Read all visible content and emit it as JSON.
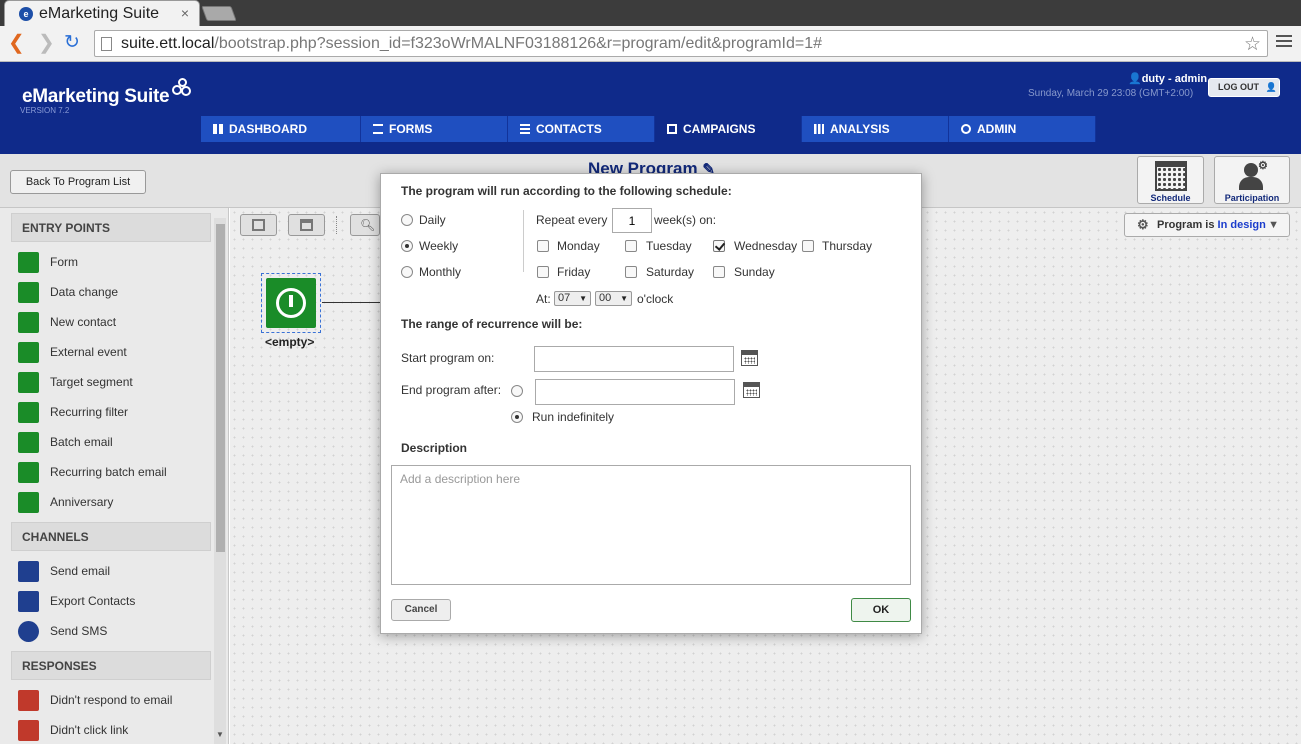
{
  "browser": {
    "tab_title": "eMarketing Suite",
    "tab_close": "×",
    "url_host": "suite.ett.local",
    "url_path": "/bootstrap.php?session_id=f323oWrMALNF03188126&r=program/edit&programId=1#"
  },
  "header": {
    "logo": "eMarketing Suite",
    "version": "VERSION 7.2",
    "user": "duty - admin",
    "datetime": "Sunday, March 29 23:08 (GMT+2:00)",
    "logout": "LOG OUT"
  },
  "nav": [
    {
      "label": "DASHBOARD",
      "icon": "grid-icon"
    },
    {
      "label": "FORMS",
      "icon": "forms-icon"
    },
    {
      "label": "CONTACTS",
      "icon": "list-icon"
    },
    {
      "label": "CAMPAIGNS",
      "icon": "campaigns-icon",
      "active": true
    },
    {
      "label": "ANALYSIS",
      "icon": "bar-chart-icon"
    },
    {
      "label": "ADMIN",
      "icon": "gear-icon"
    }
  ],
  "subheader": {
    "back_button": "Back To Program List",
    "program_title": "New Program",
    "schedule": "Schedule",
    "participation": "Participation",
    "status_prefix": "Program is ",
    "status_value": "In design"
  },
  "sidebar": {
    "entry_points_title": "ENTRY POINTS",
    "entry_points": [
      "Form",
      "Data change",
      "New contact",
      "External event",
      "Target segment",
      "Recurring filter",
      "Batch email",
      "Recurring batch email",
      "Anniversary"
    ],
    "channels_title": "CHANNELS",
    "channels": [
      "Send email",
      "Export Contacts",
      "Send SMS"
    ],
    "responses_title": "RESPONSES",
    "responses": [
      "Didn't respond to email",
      "Didn't click link"
    ]
  },
  "canvas": {
    "node_label": "<empty>"
  },
  "modal": {
    "schedule_heading": "The program will run according to the following schedule:",
    "frequency": {
      "options": [
        "Daily",
        "Weekly",
        "Monthly"
      ],
      "selected": "Weekly"
    },
    "repeat_label": "Repeat every",
    "repeat_value": "1",
    "repeat_suffix": "week(s) on:",
    "days": [
      {
        "label": "Monday",
        "checked": false
      },
      {
        "label": "Tuesday",
        "checked": false
      },
      {
        "label": "Wednesday",
        "checked": true
      },
      {
        "label": "Thursday",
        "checked": false
      },
      {
        "label": "Friday",
        "checked": false
      },
      {
        "label": "Saturday",
        "checked": false
      },
      {
        "label": "Sunday",
        "checked": false
      }
    ],
    "at_label": "At:",
    "hour": "07",
    "minute": "00",
    "oclock": "o'clock",
    "range_heading": "The range of recurrence will be:",
    "start_label": "Start program on:",
    "start_value": "",
    "end_label": "End program after:",
    "end_value": "",
    "run_indefinitely": "Run indefinitely",
    "run_indefinitely_selected": true,
    "description_heading": "Description",
    "description_placeholder": "Add a description here",
    "cancel": "Cancel",
    "ok": "OK"
  },
  "colors": {
    "header_bg": "#0f2a8a",
    "nav_bg": "#1f4fc0",
    "entry_icon": "#1a8c28",
    "channel_icon": "#1f3f8f",
    "response_icon": "#c0392b"
  }
}
